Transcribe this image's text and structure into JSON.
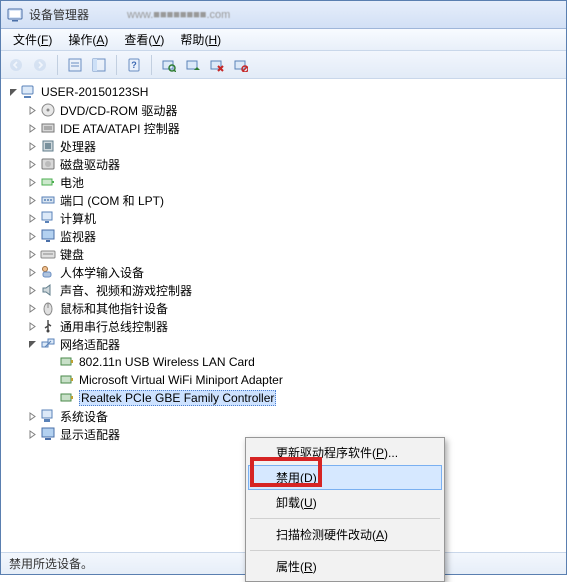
{
  "window": {
    "title": "设备管理器",
    "address_hint": "www.■■■■■■■■.com"
  },
  "menu": {
    "file": {
      "label": "文件",
      "key": "F"
    },
    "action": {
      "label": "操作",
      "key": "A"
    },
    "view": {
      "label": "查看",
      "key": "V"
    },
    "help": {
      "label": "帮助",
      "key": "H"
    }
  },
  "tree": {
    "root": "USER-20150123SH",
    "categories": [
      {
        "label": "DVD/CD-ROM 驱动器",
        "icon": "disc"
      },
      {
        "label": "IDE ATA/ATAPI 控制器",
        "icon": "ide"
      },
      {
        "label": "处理器",
        "icon": "cpu"
      },
      {
        "label": "磁盘驱动器",
        "icon": "disk"
      },
      {
        "label": "电池",
        "icon": "battery"
      },
      {
        "label": "端口 (COM 和 LPT)",
        "icon": "port"
      },
      {
        "label": "计算机",
        "icon": "computer"
      },
      {
        "label": "监视器",
        "icon": "monitor"
      },
      {
        "label": "键盘",
        "icon": "keyboard"
      },
      {
        "label": "人体学输入设备",
        "icon": "hid"
      },
      {
        "label": "声音、视频和游戏控制器",
        "icon": "sound"
      },
      {
        "label": "鼠标和其他指针设备",
        "icon": "mouse"
      },
      {
        "label": "通用串行总线控制器",
        "icon": "usb"
      },
      {
        "label": "网络适配器",
        "icon": "network",
        "expanded": true,
        "children": [
          {
            "label": "802.11n USB Wireless LAN Card",
            "icon": "nic"
          },
          {
            "label": "Microsoft Virtual WiFi Miniport Adapter",
            "icon": "nic"
          },
          {
            "label": "Realtek PCIe GBE Family Controller",
            "icon": "nic",
            "selected": true
          }
        ]
      },
      {
        "label": "系统设备",
        "icon": "system"
      },
      {
        "label": "显示适配器",
        "icon": "display"
      }
    ]
  },
  "context_menu": {
    "update": {
      "label": "更新驱动程序软件",
      "key": "P",
      "suffix": "..."
    },
    "disable": {
      "label": "禁用",
      "key": "D"
    },
    "uninst": {
      "label": "卸载",
      "key": "U"
    },
    "scan": {
      "label": "扫描检测硬件改动",
      "key": "A"
    },
    "props": {
      "label": "属性",
      "key": "R"
    }
  },
  "statusbar": {
    "text": "禁用所选设备。"
  }
}
